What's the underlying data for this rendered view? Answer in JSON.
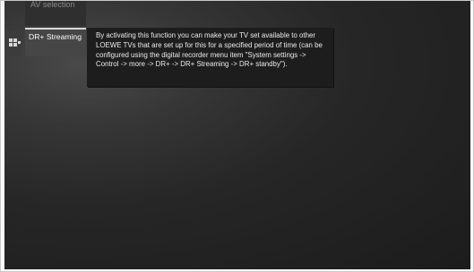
{
  "menu": {
    "previous_item_label": "AV selection",
    "selected_item_label": "DR+ Streaming"
  },
  "tooltip": {
    "text": "By activating this function you can make your TV set available to other LOEWE TVs that are set up for this for a specified period of time (can be configured using the digital recorder menu item \"System settings -> Control -> more -> DR+ -> DR+ Streaming -> DR+ standby\")."
  },
  "icons": {
    "side_icon": "grid-menu-icon"
  },
  "colors": {
    "background": "#262626",
    "menu_item": "#464646",
    "menu_highlight_line": "#d8d8d8",
    "tooltip_bg": "#1d1d1d",
    "text": "#ececec"
  }
}
